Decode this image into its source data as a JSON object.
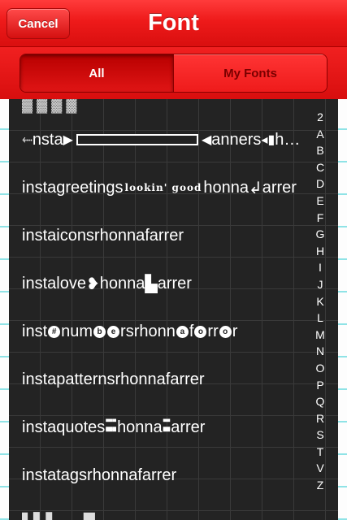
{
  "header": {
    "title": "Font",
    "cancel_label": "Cancel"
  },
  "segments": {
    "all_label": "All",
    "my_fonts_label": "My Fonts",
    "selected": "All"
  },
  "fonts": [
    {
      "name_parts": [
        "",
        "nsta",
        "",
        "anners",
        "h"
      ],
      "id": "instabanners"
    },
    {
      "name_parts": [
        "instagreetings",
        "lookin' good",
        "honna",
        "arrer"
      ],
      "id": "instagreetings"
    },
    {
      "name": "instaiconsrhonnafarrer"
    },
    {
      "name_parts": [
        "instalove",
        "honna",
        "arrer"
      ]
    },
    {
      "name_parts": [
        "inst",
        "num",
        "rsrhonn",
        "f",
        "rr",
        "r"
      ]
    },
    {
      "name": "instapatternsrhonnafarrer"
    },
    {
      "name_parts": [
        "instaquotes",
        "honna",
        "arrer"
      ]
    },
    {
      "name": "instatagsrhonnafarrer"
    }
  ],
  "index_letters": [
    "2",
    "A",
    "B",
    "C",
    "D",
    "E",
    "F",
    "G",
    "H",
    "I",
    "J",
    "K",
    "L",
    "M",
    "N",
    "O",
    "P",
    "Q",
    "R",
    "S",
    "T",
    "V",
    "Z"
  ],
  "colors": {
    "header_red": "#ee1a1a",
    "board": "#232323",
    "paper_line": "#8fe3e6"
  }
}
